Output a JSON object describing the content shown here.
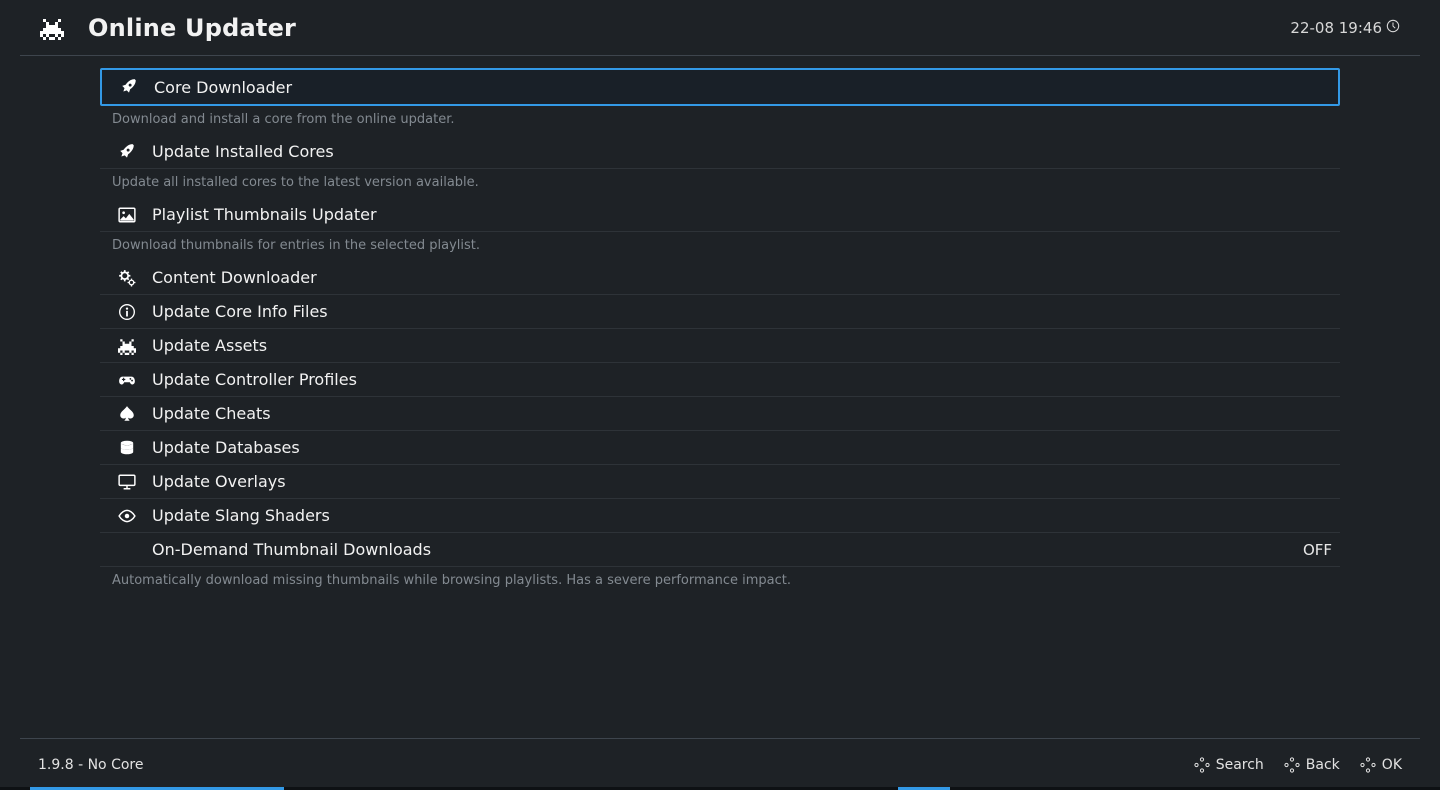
{
  "header": {
    "title": "Online Updater",
    "clock": "22-08 19:46"
  },
  "menu": {
    "items": [
      {
        "icon": "rocket",
        "label": "Core Downloader",
        "selected": true,
        "desc": "Download and install a core from the online updater."
      },
      {
        "icon": "rocket",
        "label": "Update Installed Cores",
        "selected": false,
        "desc": "Update all installed cores to the latest version available."
      },
      {
        "icon": "image",
        "label": "Playlist Thumbnails Updater",
        "selected": false,
        "desc": "Download thumbnails for entries in the selected playlist."
      },
      {
        "icon": "gears",
        "label": "Content Downloader",
        "selected": false,
        "desc": ""
      },
      {
        "icon": "info",
        "label": "Update Core Info Files",
        "selected": false,
        "desc": ""
      },
      {
        "icon": "invader",
        "label": "Update Assets",
        "selected": false,
        "desc": ""
      },
      {
        "icon": "gamepad",
        "label": "Update Controller Profiles",
        "selected": false,
        "desc": ""
      },
      {
        "icon": "spade",
        "label": "Update Cheats",
        "selected": false,
        "desc": ""
      },
      {
        "icon": "database",
        "label": "Update Databases",
        "selected": false,
        "desc": ""
      },
      {
        "icon": "monitor",
        "label": "Update Overlays",
        "selected": false,
        "desc": ""
      },
      {
        "icon": "eye",
        "label": "Update Slang Shaders",
        "selected": false,
        "desc": ""
      },
      {
        "icon": "",
        "label": "On-Demand Thumbnail Downloads",
        "selected": false,
        "desc": "Automatically download missing thumbnails while browsing playlists. Has a severe performance impact.",
        "value": "OFF"
      }
    ]
  },
  "footer": {
    "version": "1.9.8 - No Core",
    "hints": [
      {
        "label": "Search"
      },
      {
        "label": "Back"
      },
      {
        "label": "OK"
      }
    ]
  }
}
